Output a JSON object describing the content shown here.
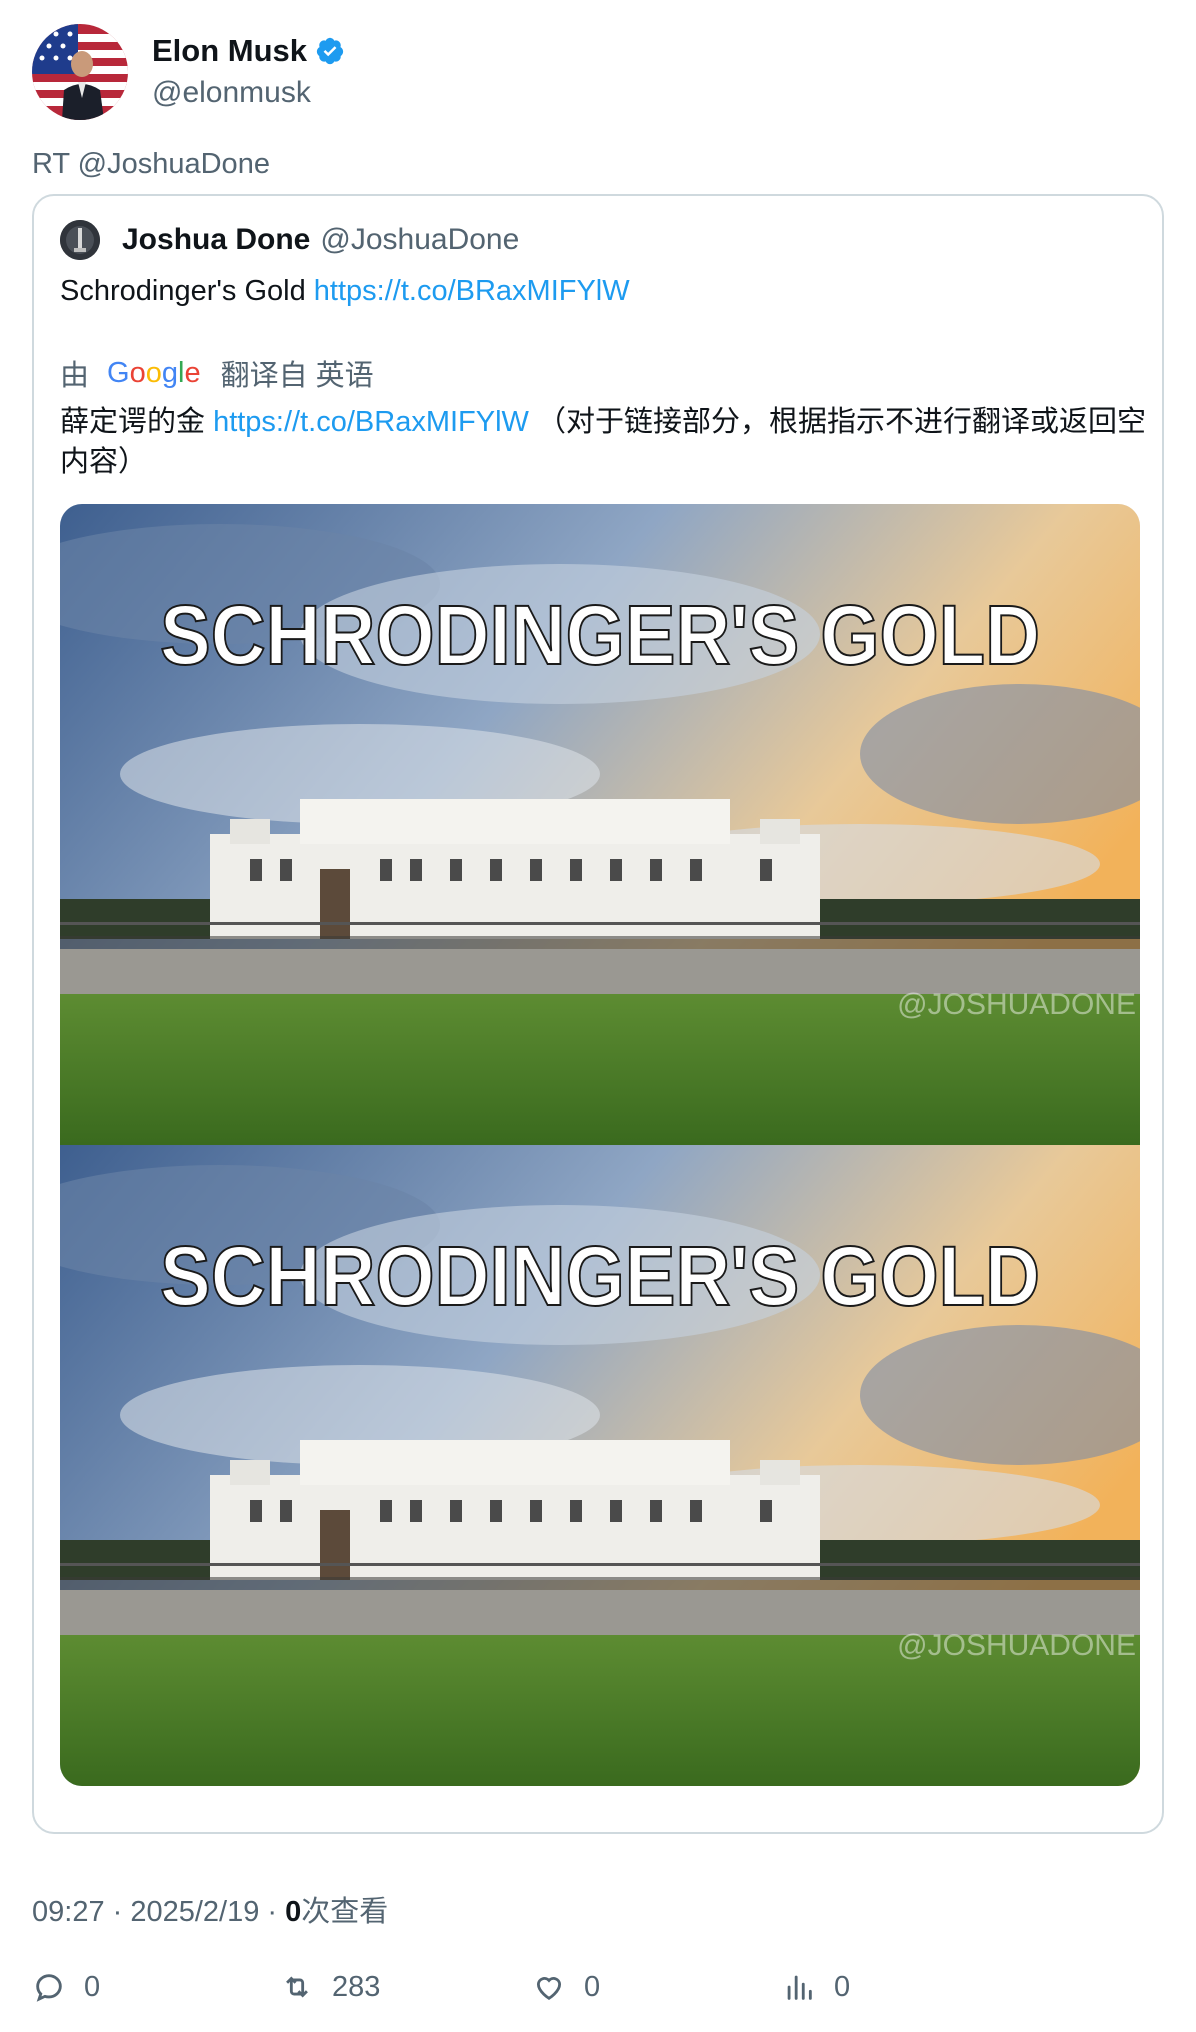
{
  "author": {
    "display_name": "Elon Musk",
    "handle": "@elonmusk",
    "verified_icon": "verified-badge-icon"
  },
  "retweet_label": "RT @JoshuaDone",
  "quote": {
    "display_name": "Joshua Done",
    "handle": "@JoshuaDone",
    "text": "Schrodinger's Gold ",
    "link": "https://t.co/BRaxMIFYlW",
    "translation": {
      "prefix": "由",
      "provider": "Google",
      "suffix": "翻译自 英语",
      "text_before_link": "薛定谔的金 ",
      "link": "https://t.co/BRaxMIFYlW",
      "text_after_link": " （对于链接部分，根据指示不进行翻译或返回空内容）"
    },
    "media": {
      "caption_top": "SCHRODINGER'S GOLD",
      "caption_bottom": "SCHRODINGER'S GOLD",
      "watermark_top": "@JOSHUADONE",
      "watermark_bottom": "@JOSHUADONE"
    }
  },
  "meta": {
    "time_date": "09:27 · 2025/2/19 · ",
    "views_count": "0",
    "views_label": "次查看"
  },
  "actions": {
    "replies": "0",
    "retweets": "283",
    "likes": "0",
    "views": "0"
  },
  "colors": {
    "link": "#1d9bf0",
    "muted": "#536471",
    "verified": "#1d9bf0"
  }
}
